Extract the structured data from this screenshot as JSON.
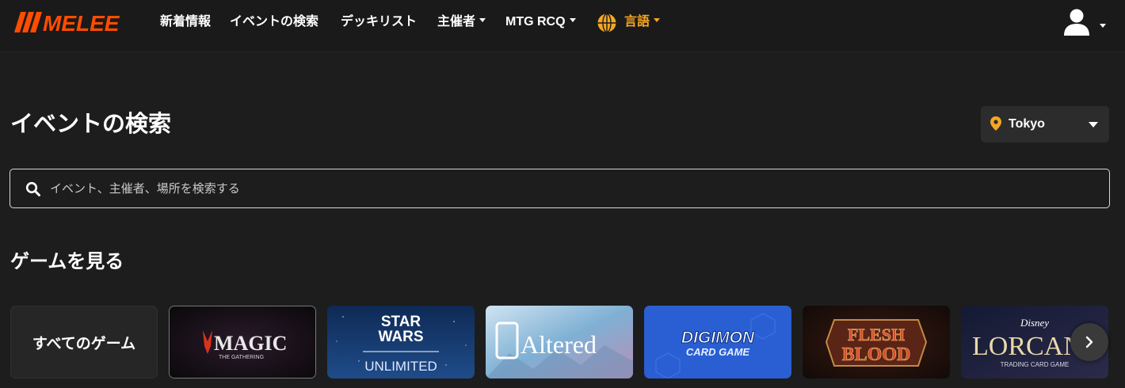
{
  "brand": {
    "logo_text": "MELEE",
    "accent": "#ff4d00"
  },
  "nav": {
    "news": "新着情報",
    "event_search": "イベントの検索",
    "decklists": "デッキリスト",
    "organizers": "主催者",
    "mtg_rcq": "MTG RCQ",
    "language": "言語",
    "language_color": "#f5a623"
  },
  "header": {
    "title": "イベントの検索",
    "location": "Tokyo"
  },
  "search": {
    "placeholder": "イベント、主催者、場所を検索する"
  },
  "games": {
    "section_title": "ゲームを見る",
    "all_games_label": "すべてのゲーム",
    "cards": [
      {
        "id": "magic",
        "title": "MAGIC",
        "subtitle": "THE GATHERING"
      },
      {
        "id": "star-wars",
        "title_line1": "STAR",
        "title_line2": "WARS",
        "subtitle": "UNLIMITED"
      },
      {
        "id": "altered",
        "title": "Altered"
      },
      {
        "id": "digimon",
        "title": "DIGIMON",
        "subtitle": "CARD GAME"
      },
      {
        "id": "flesh-and-blood",
        "title_line1": "FLESH",
        "title_line2": "BLOOD"
      },
      {
        "id": "lorcana",
        "brand": "Disney",
        "title": "LORCANA",
        "subtitle": "TRADING CARD GAME"
      }
    ]
  },
  "icons": {
    "globe": "globe-icon",
    "user": "user-icon",
    "pin": "map-pin-icon",
    "search": "search-icon",
    "next": "chevron-right-icon"
  }
}
